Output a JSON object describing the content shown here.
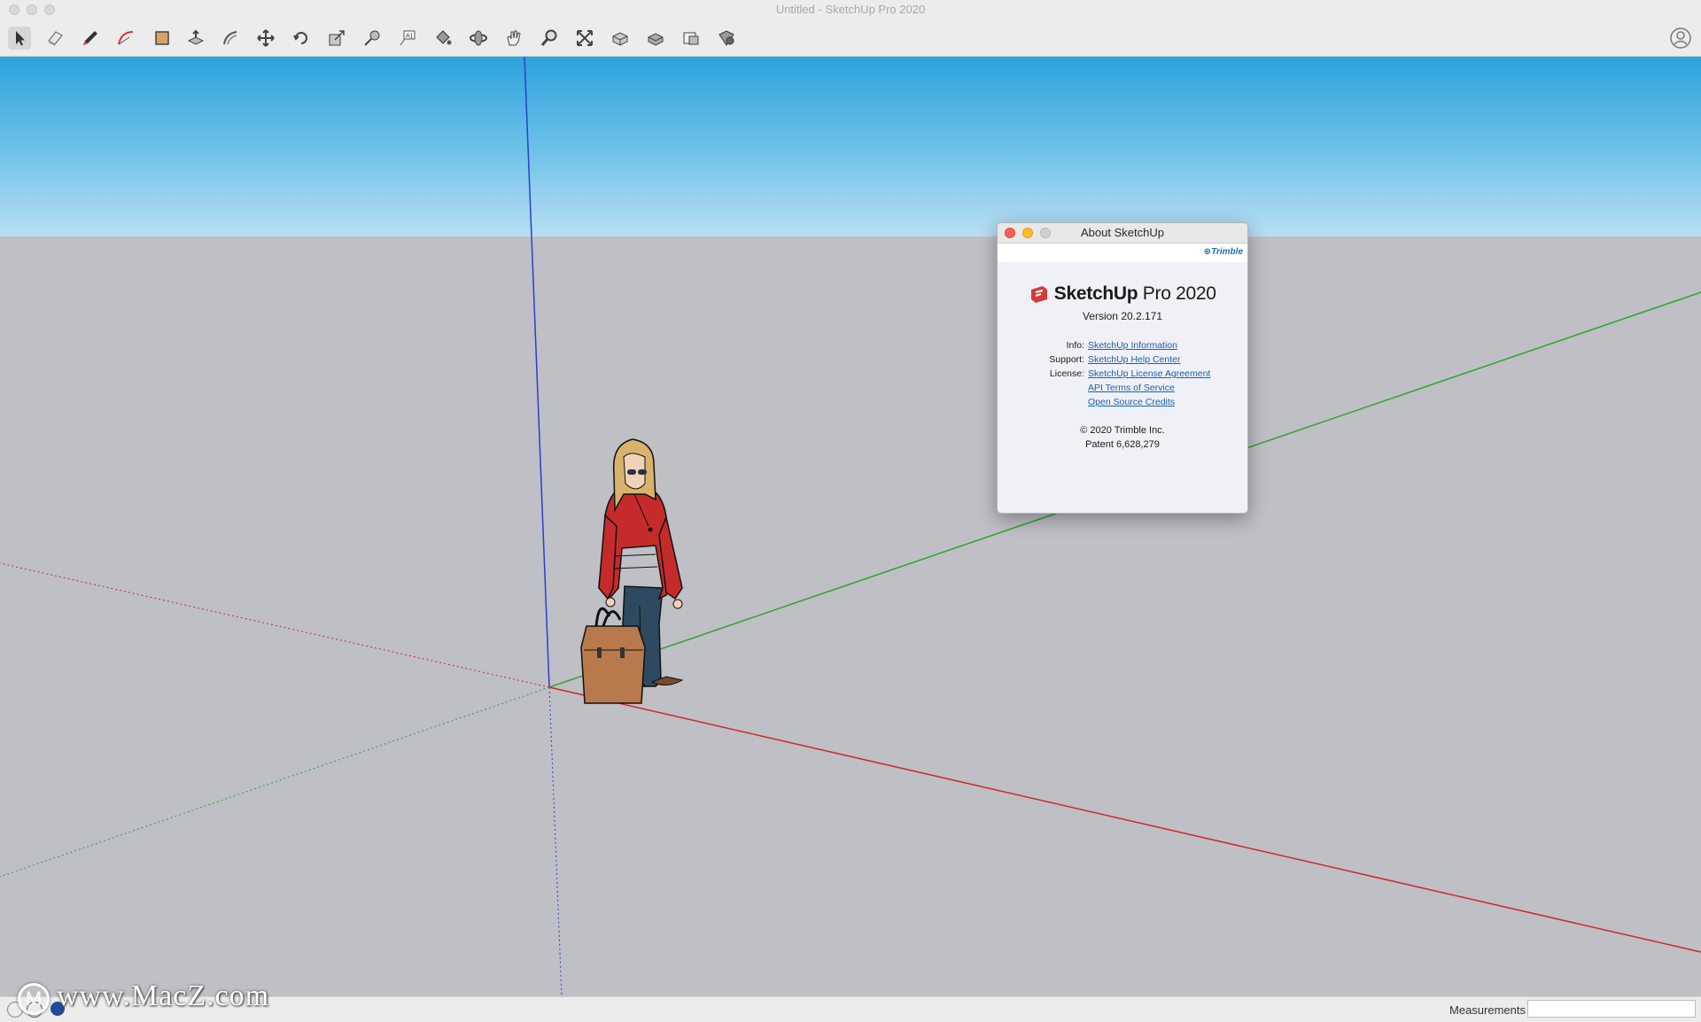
{
  "window": {
    "title": "Untitled - SketchUp Pro 2020"
  },
  "toolbar": {
    "tools": [
      {
        "name": "select-icon"
      },
      {
        "name": "eraser-icon"
      },
      {
        "name": "pencil-icon"
      },
      {
        "name": "arc-icon"
      },
      {
        "name": "rectangle-icon"
      },
      {
        "name": "push-pull-icon"
      },
      {
        "name": "offset-icon"
      },
      {
        "name": "move-icon"
      },
      {
        "name": "rotate-icon"
      },
      {
        "name": "scale-icon"
      },
      {
        "name": "tape-measure-icon"
      },
      {
        "name": "text-icon"
      },
      {
        "name": "paint-bucket-icon"
      },
      {
        "name": "orbit-icon"
      },
      {
        "name": "pan-icon"
      },
      {
        "name": "zoom-icon"
      },
      {
        "name": "zoom-extents-icon"
      },
      {
        "name": "3d-warehouse-icon"
      },
      {
        "name": "extension-warehouse-icon"
      },
      {
        "name": "layout-icon"
      },
      {
        "name": "extension-manager-icon"
      }
    ],
    "account_icon": "user-account-icon"
  },
  "about_dialog": {
    "title": "About SketchUp",
    "brand": "Trimble",
    "product_bold": "SketchUp",
    "product_rest": " Pro 2020",
    "version": "Version 20.2.171",
    "links": [
      {
        "key": "Info:",
        "value": "SketchUp Information"
      },
      {
        "key": "Support:",
        "value": "SketchUp Help Center"
      },
      {
        "key": "License:",
        "value": "SketchUp License Agreement"
      },
      {
        "key": "",
        "value": "API Terms of Service"
      },
      {
        "key": "",
        "value": "Open Source Credits"
      }
    ],
    "copyright": "© 2020 Trimble Inc.",
    "patent": "Patent 6,628,279"
  },
  "statusbar": {
    "measurements_label": "Measurements",
    "measurements_value": ""
  },
  "watermark": "www.MacZ.com",
  "colors": {
    "sky_top": "#2ca3dc",
    "ground": "#bfbfc6",
    "axis_red": "#cc2a2a",
    "axis_green": "#2fa52f",
    "axis_blue": "#2b3fcc",
    "link": "#1b5fae"
  }
}
